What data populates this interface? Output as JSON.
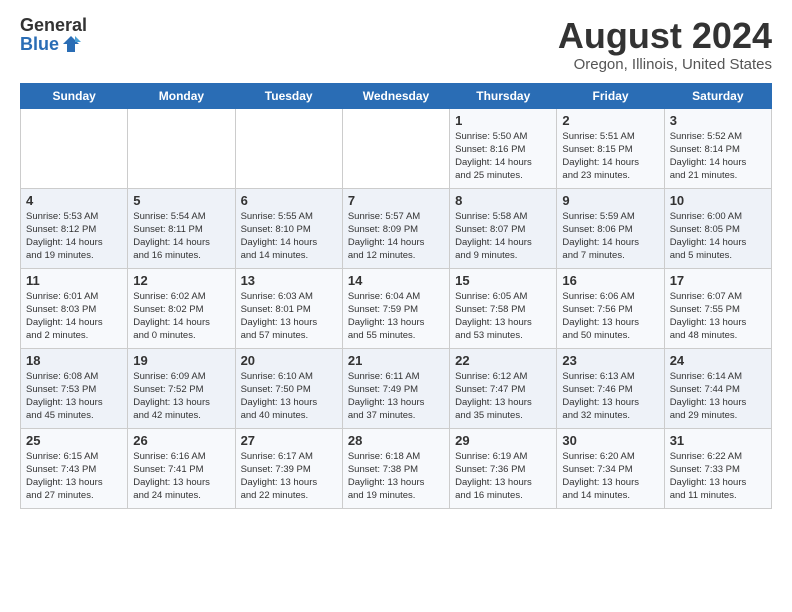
{
  "header": {
    "logo_general": "General",
    "logo_blue": "Blue",
    "main_title": "August 2024",
    "subtitle": "Oregon, Illinois, United States"
  },
  "days_of_week": [
    "Sunday",
    "Monday",
    "Tuesday",
    "Wednesday",
    "Thursday",
    "Friday",
    "Saturday"
  ],
  "weeks": [
    [
      {
        "day": "",
        "lines": []
      },
      {
        "day": "",
        "lines": []
      },
      {
        "day": "",
        "lines": []
      },
      {
        "day": "",
        "lines": []
      },
      {
        "day": "1",
        "lines": [
          "Sunrise: 5:50 AM",
          "Sunset: 8:16 PM",
          "Daylight: 14 hours",
          "and 25 minutes."
        ]
      },
      {
        "day": "2",
        "lines": [
          "Sunrise: 5:51 AM",
          "Sunset: 8:15 PM",
          "Daylight: 14 hours",
          "and 23 minutes."
        ]
      },
      {
        "day": "3",
        "lines": [
          "Sunrise: 5:52 AM",
          "Sunset: 8:14 PM",
          "Daylight: 14 hours",
          "and 21 minutes."
        ]
      }
    ],
    [
      {
        "day": "4",
        "lines": [
          "Sunrise: 5:53 AM",
          "Sunset: 8:12 PM",
          "Daylight: 14 hours",
          "and 19 minutes."
        ]
      },
      {
        "day": "5",
        "lines": [
          "Sunrise: 5:54 AM",
          "Sunset: 8:11 PM",
          "Daylight: 14 hours",
          "and 16 minutes."
        ]
      },
      {
        "day": "6",
        "lines": [
          "Sunrise: 5:55 AM",
          "Sunset: 8:10 PM",
          "Daylight: 14 hours",
          "and 14 minutes."
        ]
      },
      {
        "day": "7",
        "lines": [
          "Sunrise: 5:57 AM",
          "Sunset: 8:09 PM",
          "Daylight: 14 hours",
          "and 12 minutes."
        ]
      },
      {
        "day": "8",
        "lines": [
          "Sunrise: 5:58 AM",
          "Sunset: 8:07 PM",
          "Daylight: 14 hours",
          "and 9 minutes."
        ]
      },
      {
        "day": "9",
        "lines": [
          "Sunrise: 5:59 AM",
          "Sunset: 8:06 PM",
          "Daylight: 14 hours",
          "and 7 minutes."
        ]
      },
      {
        "day": "10",
        "lines": [
          "Sunrise: 6:00 AM",
          "Sunset: 8:05 PM",
          "Daylight: 14 hours",
          "and 5 minutes."
        ]
      }
    ],
    [
      {
        "day": "11",
        "lines": [
          "Sunrise: 6:01 AM",
          "Sunset: 8:03 PM",
          "Daylight: 14 hours",
          "and 2 minutes."
        ]
      },
      {
        "day": "12",
        "lines": [
          "Sunrise: 6:02 AM",
          "Sunset: 8:02 PM",
          "Daylight: 14 hours",
          "and 0 minutes."
        ]
      },
      {
        "day": "13",
        "lines": [
          "Sunrise: 6:03 AM",
          "Sunset: 8:01 PM",
          "Daylight: 13 hours",
          "and 57 minutes."
        ]
      },
      {
        "day": "14",
        "lines": [
          "Sunrise: 6:04 AM",
          "Sunset: 7:59 PM",
          "Daylight: 13 hours",
          "and 55 minutes."
        ]
      },
      {
        "day": "15",
        "lines": [
          "Sunrise: 6:05 AM",
          "Sunset: 7:58 PM",
          "Daylight: 13 hours",
          "and 53 minutes."
        ]
      },
      {
        "day": "16",
        "lines": [
          "Sunrise: 6:06 AM",
          "Sunset: 7:56 PM",
          "Daylight: 13 hours",
          "and 50 minutes."
        ]
      },
      {
        "day": "17",
        "lines": [
          "Sunrise: 6:07 AM",
          "Sunset: 7:55 PM",
          "Daylight: 13 hours",
          "and 48 minutes."
        ]
      }
    ],
    [
      {
        "day": "18",
        "lines": [
          "Sunrise: 6:08 AM",
          "Sunset: 7:53 PM",
          "Daylight: 13 hours",
          "and 45 minutes."
        ]
      },
      {
        "day": "19",
        "lines": [
          "Sunrise: 6:09 AM",
          "Sunset: 7:52 PM",
          "Daylight: 13 hours",
          "and 42 minutes."
        ]
      },
      {
        "day": "20",
        "lines": [
          "Sunrise: 6:10 AM",
          "Sunset: 7:50 PM",
          "Daylight: 13 hours",
          "and 40 minutes."
        ]
      },
      {
        "day": "21",
        "lines": [
          "Sunrise: 6:11 AM",
          "Sunset: 7:49 PM",
          "Daylight: 13 hours",
          "and 37 minutes."
        ]
      },
      {
        "day": "22",
        "lines": [
          "Sunrise: 6:12 AM",
          "Sunset: 7:47 PM",
          "Daylight: 13 hours",
          "and 35 minutes."
        ]
      },
      {
        "day": "23",
        "lines": [
          "Sunrise: 6:13 AM",
          "Sunset: 7:46 PM",
          "Daylight: 13 hours",
          "and 32 minutes."
        ]
      },
      {
        "day": "24",
        "lines": [
          "Sunrise: 6:14 AM",
          "Sunset: 7:44 PM",
          "Daylight: 13 hours",
          "and 29 minutes."
        ]
      }
    ],
    [
      {
        "day": "25",
        "lines": [
          "Sunrise: 6:15 AM",
          "Sunset: 7:43 PM",
          "Daylight: 13 hours",
          "and 27 minutes."
        ]
      },
      {
        "day": "26",
        "lines": [
          "Sunrise: 6:16 AM",
          "Sunset: 7:41 PM",
          "Daylight: 13 hours",
          "and 24 minutes."
        ]
      },
      {
        "day": "27",
        "lines": [
          "Sunrise: 6:17 AM",
          "Sunset: 7:39 PM",
          "Daylight: 13 hours",
          "and 22 minutes."
        ]
      },
      {
        "day": "28",
        "lines": [
          "Sunrise: 6:18 AM",
          "Sunset: 7:38 PM",
          "Daylight: 13 hours",
          "and 19 minutes."
        ]
      },
      {
        "day": "29",
        "lines": [
          "Sunrise: 6:19 AM",
          "Sunset: 7:36 PM",
          "Daylight: 13 hours",
          "and 16 minutes."
        ]
      },
      {
        "day": "30",
        "lines": [
          "Sunrise: 6:20 AM",
          "Sunset: 7:34 PM",
          "Daylight: 13 hours",
          "and 14 minutes."
        ]
      },
      {
        "day": "31",
        "lines": [
          "Sunrise: 6:22 AM",
          "Sunset: 7:33 PM",
          "Daylight: 13 hours",
          "and 11 minutes."
        ]
      }
    ]
  ]
}
